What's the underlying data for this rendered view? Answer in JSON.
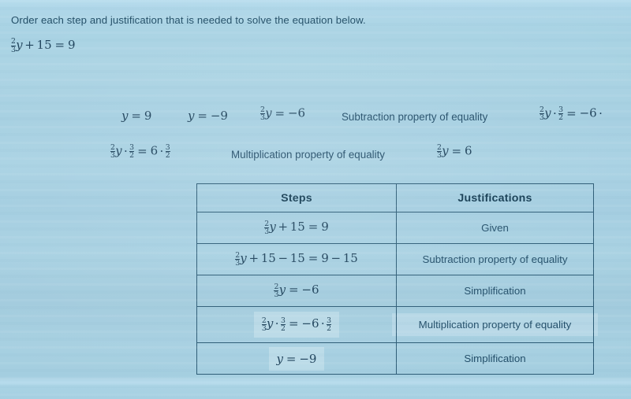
{
  "prompt": "Order each step and justification that is needed to solve the equation below.",
  "equation": {
    "frac_num": "2",
    "frac_den": "3",
    "var": "y",
    "plus": "+",
    "fifteen": "15",
    "equals": "=",
    "nine": "9"
  },
  "bank": {
    "items": [
      {
        "id": "y-eq-9",
        "kind": "math",
        "text": "y = 9"
      },
      {
        "id": "y-eq-neg9",
        "kind": "math",
        "text": "y = −9"
      },
      {
        "id": "twothirds-neg6",
        "kind": "math",
        "text": "2/3 y = −6"
      },
      {
        "id": "subtraction-prop",
        "kind": "word",
        "text": "Subtraction property of equality"
      },
      {
        "id": "mult-neg6",
        "kind": "math",
        "text": "2/3 y · 3/2 = −6 ·"
      },
      {
        "id": "mult-pos6",
        "kind": "math",
        "text": "2/3 y · 3/2 = 6 · 3/2"
      },
      {
        "id": "multiplication-prop",
        "kind": "word",
        "text": "Multiplication property of equality"
      },
      {
        "id": "twothirds-6",
        "kind": "math",
        "text": "2/3 y = 6"
      }
    ]
  },
  "table": {
    "headers": {
      "steps": "Steps",
      "justifications": "Justifications"
    },
    "rows": [
      {
        "step": "2/3 y + 15 = 9",
        "justification": "Given"
      },
      {
        "step": "2/3 y + 15 − 15 = 9 − 15",
        "justification": "Subtraction property of equality"
      },
      {
        "step": "2/3 y = −6",
        "justification": "Simplification"
      },
      {
        "step": "2/3 y · 3/2 = −6 · 3/2",
        "justification": "Multiplication property of equality"
      },
      {
        "step": "y = −9",
        "justification": "Simplification"
      }
    ]
  },
  "colors": {
    "background": "#a7d2e3",
    "text": "#1f4a66",
    "math_text": "#1b3f58",
    "border": "#2b5a74",
    "header_text": "#10384f"
  }
}
